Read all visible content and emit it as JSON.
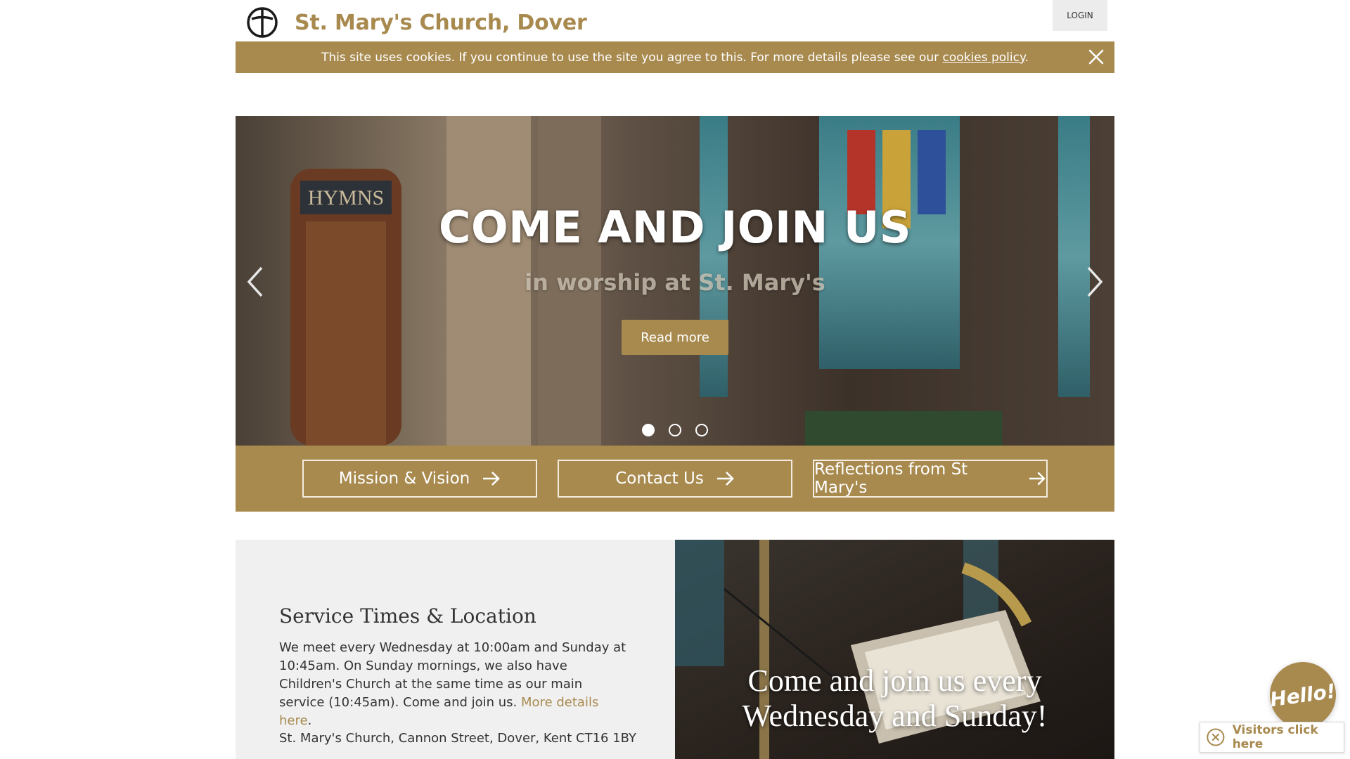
{
  "header": {
    "site_title": "St. Mary's Church, Dover",
    "login_label": "LOGIN"
  },
  "cookie": {
    "text": "This site uses cookies. If you continue to use the site you agree to this. For more details please see our",
    "link_text": "cookies policy",
    "suffix": "."
  },
  "hero": {
    "title": "COME AND JOIN US",
    "subtitle": "in worship at St. Mary's",
    "button_label": "Read more",
    "slides": 3,
    "active_slide": 1
  },
  "band": {
    "buttons": [
      {
        "label": "Mission & Vision"
      },
      {
        "label": "Contact Us"
      },
      {
        "label": "Reflections from St Mary's"
      }
    ]
  },
  "service": {
    "heading": "Service Times & Location",
    "paragraph": "We meet every Wednesday at 10:00am and Sunday at 10:45am. On Sunday mornings, we also have Children's Church at the same time as our main service (10:45am). Come and join us.",
    "link_text": "More details here",
    "link_suffix": ".",
    "address": "St. Mary's Church, Cannon Street, Dover, Kent CT16 1BY"
  },
  "join": {
    "text": "Come and join us every Wednesday and Sunday!"
  },
  "widget": {
    "hello_label": "Hello!",
    "visitors_label": "Visitors click here"
  },
  "colors": {
    "brand_gold": "#a88a4f",
    "light_grey": "#f0f0f0"
  }
}
